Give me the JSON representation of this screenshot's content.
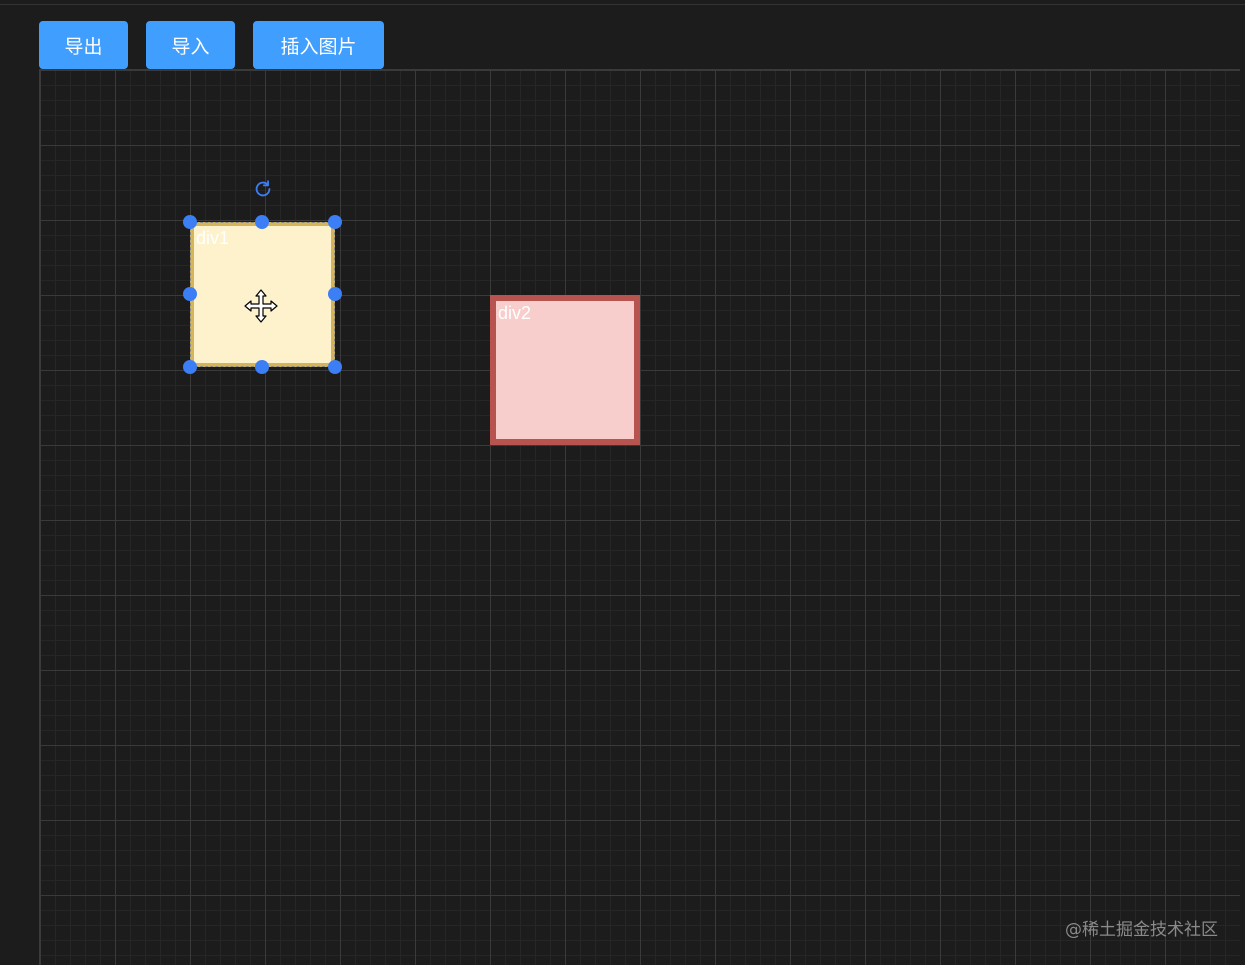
{
  "toolbar": {
    "export_label": "导出",
    "import_label": "导入",
    "insert_image_label": "插入图片"
  },
  "canvas": {
    "elements": [
      {
        "label": "div1",
        "fill": "#fef2cd",
        "stroke": "#d5b55a",
        "selected": true
      },
      {
        "label": "div2",
        "fill": "#f8cecc",
        "stroke": "#b85450",
        "selected": false
      }
    ]
  },
  "colors": {
    "accent": "#409eff",
    "handle": "#3b7ef5"
  },
  "icons": {
    "rotate": "rotate-icon",
    "move": "move-cursor-icon"
  },
  "watermark": "@稀土掘金技术社区"
}
